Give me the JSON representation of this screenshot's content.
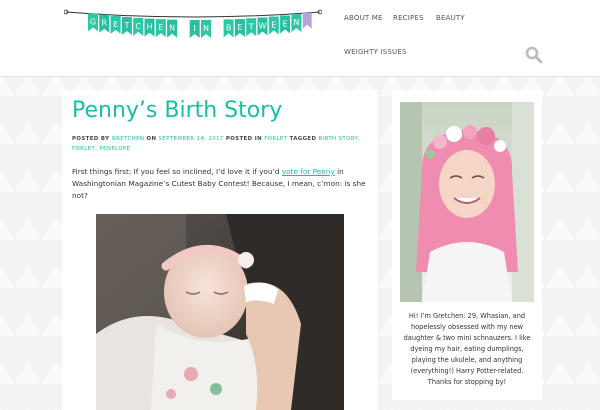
{
  "site": {
    "banner_letters": [
      "G",
      "R",
      "E",
      "T",
      "C",
      "H",
      "E",
      "N",
      "",
      "I",
      "N",
      "",
      "B",
      "E",
      "T",
      "W",
      "E",
      "E",
      "N"
    ],
    "banner_colors": [
      "#2ec7a6",
      "#26bfa0"
    ]
  },
  "nav": {
    "items": [
      {
        "label": "ABOUT ME"
      },
      {
        "label": "RECIPES"
      },
      {
        "label": "BEAUTY"
      },
      {
        "label": "WEIGHTY ISSUES"
      }
    ],
    "search_icon": "search-icon"
  },
  "post": {
    "title": "Penny’s Birth Story",
    "meta": {
      "posted_by_label": "POSTED BY",
      "author": "GRETCHEN",
      "on_label": "ON",
      "date": "SEPTEMBER 14, 2017",
      "posted_in_label": "POSTED IN",
      "category": "FORLET",
      "tagged_label": "TAGGED",
      "tag1": "BIRTH STORY",
      "tag2": "FORLET",
      "tag3": "PENELOPE"
    },
    "body": {
      "before_link": "First things first: If you feel so inclined, I’d love it if you’d ",
      "link_text": "vote for Penny",
      "after_link": " in Washingtonian Magazine’s Cutest Baby Contest! Because, I mean, c’mon: is she not?"
    },
    "photo_icon": "baby-photo"
  },
  "sidebar": {
    "portrait_icon": "author-portrait",
    "bio": "Hi! I’m Gretchen: 29, Whasian, and hopelessly obsessed with my new daughter & two mini schnauzers. I like dyeing my hair, eating dumplings, playing the ukulele, and anything (everything!) Harry Potter-related. Thanks for stopping by!"
  }
}
